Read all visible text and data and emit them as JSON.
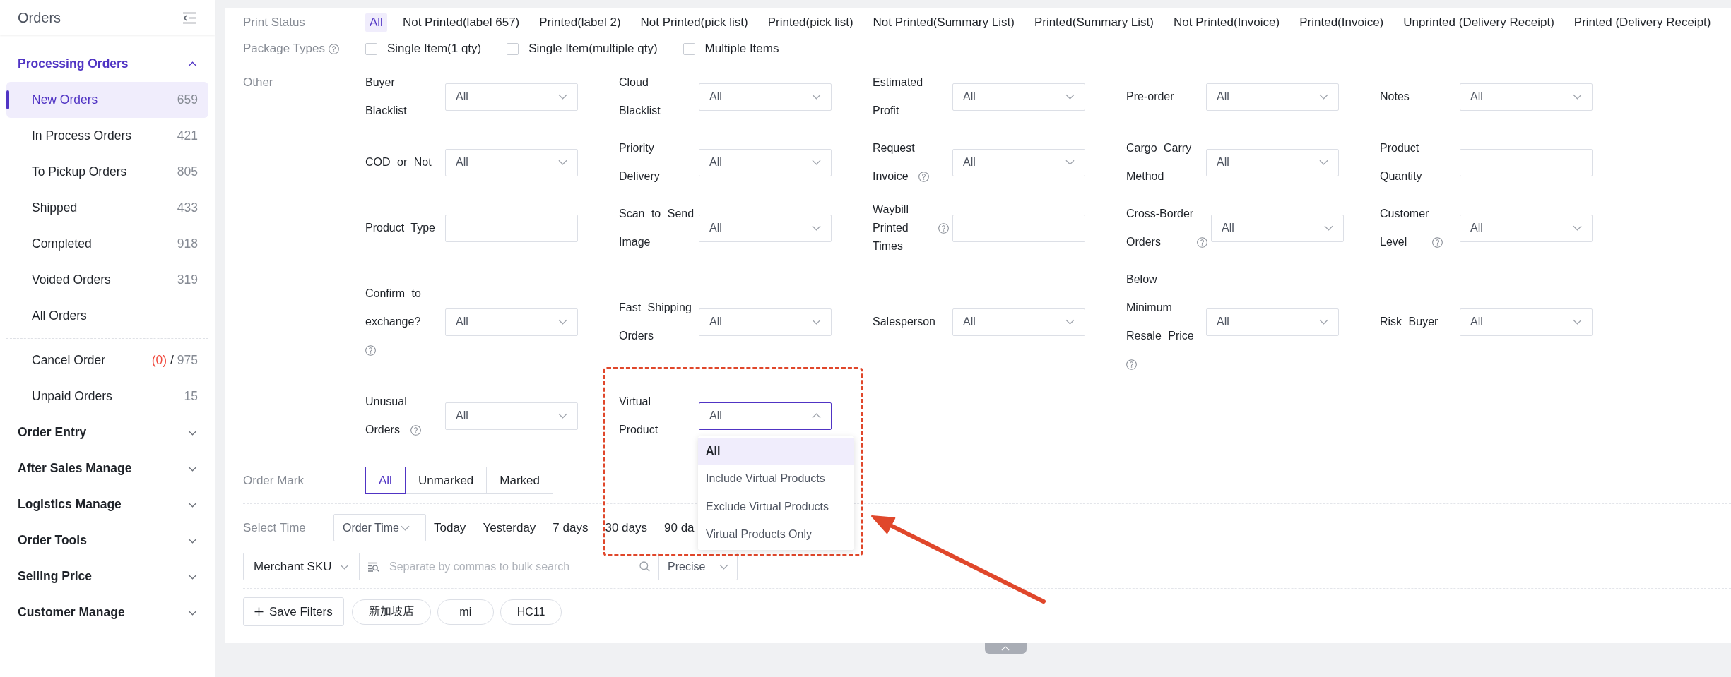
{
  "sidebar": {
    "title": "Orders",
    "groups": [
      {
        "label": "Processing Orders",
        "expanded": true,
        "sections": [
          {
            "items": [
              {
                "label": "New Orders",
                "count": "659",
                "selected": true
              },
              {
                "label": "In Process Orders",
                "count": "421",
                "selected": false
              },
              {
                "label": "To Pickup Orders",
                "count": "805",
                "selected": false
              },
              {
                "label": "Shipped",
                "count": "433",
                "selected": false
              },
              {
                "label": "Completed",
                "count": "918",
                "selected": false
              },
              {
                "label": "Voided Orders",
                "count": "319",
                "selected": false
              },
              {
                "label": "All Orders",
                "selected": false
              }
            ]
          },
          {
            "items": [
              {
                "label": "Cancel Order",
                "alert_count": "(0)",
                "separator": "/",
                "count": "975",
                "selected": false
              },
              {
                "label": "Unpaid Orders",
                "count": "15",
                "selected": false
              }
            ]
          }
        ]
      },
      {
        "label": "Order Entry",
        "expanded": false
      },
      {
        "label": "After Sales Manage",
        "expanded": false
      },
      {
        "label": "Logistics Manage",
        "expanded": false
      },
      {
        "label": "Order Tools",
        "expanded": false
      },
      {
        "label": "Selling Price",
        "expanded": false
      },
      {
        "label": "Customer Manage",
        "expanded": false
      }
    ]
  },
  "filters": {
    "print_status": {
      "label": "Print Status",
      "options": [
        {
          "label": "All",
          "selected": true
        },
        {
          "label": "Not Printed(label 657)",
          "selected": false
        },
        {
          "label": "Printed(label 2)",
          "selected": false
        },
        {
          "label": "Not Printed(pick list)",
          "selected": false
        },
        {
          "label": "Printed(pick list)",
          "selected": false
        },
        {
          "label": "Not Printed(Summary List)",
          "selected": false
        },
        {
          "label": "Printed(Summary List)",
          "selected": false
        },
        {
          "label": "Not Printed(Invoice)",
          "selected": false
        },
        {
          "label": "Printed(Invoice)",
          "selected": false
        },
        {
          "label": "Unprinted (Delivery Receipt)",
          "selected": false
        },
        {
          "label": "Printed (Delivery Receipt)",
          "selected": false
        }
      ]
    },
    "package_types": {
      "label": "Package Types",
      "help": {
        "kind": "inline"
      },
      "options": [
        {
          "label": "Single Item(1 qty)",
          "checked": false
        },
        {
          "label": "Single Item(multiple qty)",
          "checked": false
        },
        {
          "label": "Multiple Items",
          "checked": false
        }
      ]
    },
    "other": {
      "label": "Other",
      "fields": [
        {
          "label": "Buyer Blacklist",
          "kind": "select",
          "value": "All",
          "open": false
        },
        {
          "label": "Cloud Blacklist",
          "kind": "select",
          "value": "All",
          "open": false
        },
        {
          "label": "Estimated Profit",
          "kind": "select",
          "value": "All",
          "open": false
        },
        {
          "label": "Pre-order",
          "kind": "select",
          "value": "All",
          "open": false
        },
        {
          "label": "Notes",
          "kind": "select",
          "value": "All",
          "open": false
        },
        {
          "label": "COD or Not",
          "kind": "select",
          "value": "All",
          "open": false
        },
        {
          "label": "Priority Delivery",
          "kind": "select",
          "value": "All",
          "open": false
        },
        {
          "label": "Request Invoice",
          "help": {
            "kind": "inline"
          },
          "kind": "select",
          "value": "All",
          "open": false
        },
        {
          "label": "Cargo Carry Method",
          "kind": "select",
          "value": "All",
          "open": false
        },
        {
          "label": "Product Quantity",
          "kind": "input"
        },
        {
          "label": "Product Type",
          "kind": "input"
        },
        {
          "label": "Scan to Send Image",
          "kind": "select",
          "value": "All",
          "open": false
        },
        {
          "label": "Waybill Printed Times",
          "help": {
            "kind": "beside"
          },
          "kind": "input"
        },
        {
          "label": "Cross-Border Orders",
          "help": {
            "kind": "inline"
          },
          "kind": "select",
          "value": "All",
          "open": false
        },
        {
          "label": "Customer Level",
          "help": {
            "kind": "inline"
          },
          "kind": "select",
          "value": "All",
          "open": false
        },
        {
          "label": "Confirm to exchange?",
          "help": {
            "kind": "below"
          },
          "kind": "select",
          "value": "All",
          "open": false
        },
        {
          "label": "Fast Shipping Orders",
          "kind": "select",
          "value": "All",
          "open": false
        },
        {
          "label": "Salesperson",
          "kind": "select",
          "value": "All",
          "open": false
        },
        {
          "label": "Below Minimum Resale Price",
          "help": {
            "kind": "below"
          },
          "kind": "select",
          "value": "All",
          "open": false
        },
        {
          "label": "Risk Buyer",
          "kind": "select",
          "value": "All",
          "open": false
        },
        {
          "label": "Unusual Orders",
          "help": {
            "kind": "inline"
          },
          "kind": "select",
          "value": "All",
          "open": false
        },
        {
          "label": "Virtual Product",
          "kind": "select",
          "value": "All",
          "open": true,
          "options": [
            {
              "label": "All",
              "selected": true
            },
            {
              "label": "Include Virtual Products",
              "selected": false
            },
            {
              "label": "Exclude Virtual Products",
              "selected": false
            },
            {
              "label": "Virtual Products Only",
              "selected": false
            }
          ]
        }
      ]
    },
    "order_mark": {
      "label": "Order Mark",
      "options": [
        {
          "label": "All",
          "selected": true
        },
        {
          "label": "Unmarked",
          "selected": false
        },
        {
          "label": "Marked",
          "selected": false
        }
      ]
    },
    "select_time": {
      "label": "Select Time",
      "time_field": {
        "value": "Order Time"
      },
      "options": [
        {
          "label": "Today",
          "selected": false
        },
        {
          "label": "Yesterday",
          "selected": false
        },
        {
          "label": "7 days",
          "selected": false
        },
        {
          "label": "30 days",
          "selected": false
        },
        {
          "label": "90 da",
          "selected": false
        }
      ]
    },
    "search_bar": {
      "field": {
        "value": "Merchant SKU"
      },
      "input": {
        "placeholder": "Separate by commas to bulk search"
      },
      "match": {
        "value": "Precise"
      }
    },
    "saved_filters": {
      "button": "Save Filters",
      "tags": [
        {
          "label": "新加坡店"
        },
        {
          "label": "mi"
        },
        {
          "label": "HC11"
        }
      ]
    }
  }
}
